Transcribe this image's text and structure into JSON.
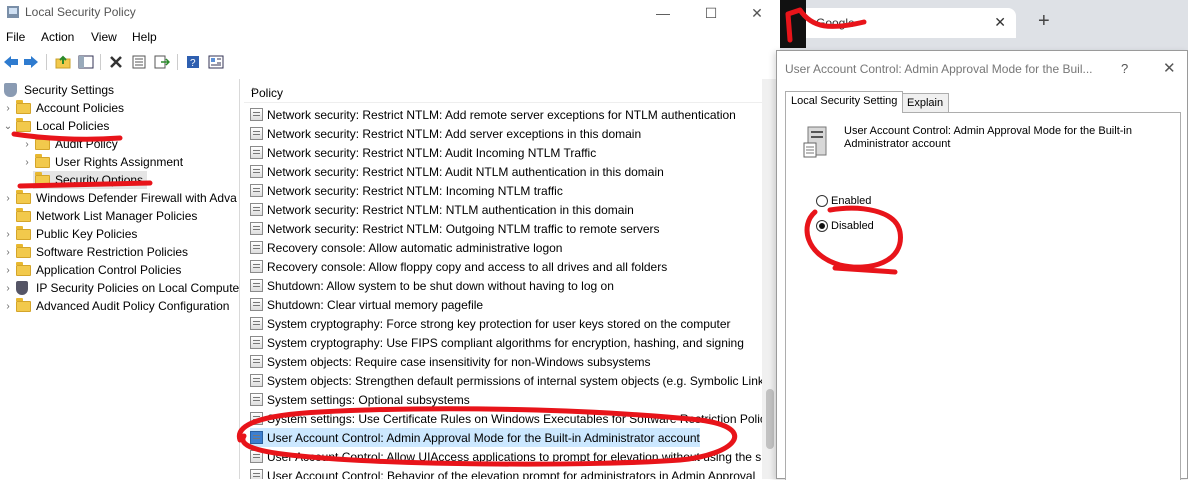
{
  "window": {
    "title": "Local Security Policy",
    "controls": {
      "minimize": "—",
      "maximize": "☐",
      "close": "✕"
    }
  },
  "menu": [
    "File",
    "Action",
    "View",
    "Help"
  ],
  "toolbar_icons": [
    "back-icon",
    "forward-icon",
    "up-folder-icon",
    "show-hide-tree-icon",
    "delete-icon",
    "properties-icon",
    "export-icon",
    "help-icon",
    "details-icon"
  ],
  "tree": {
    "items": [
      {
        "label": "Security Settings"
      },
      {
        "label": "Account Policies"
      },
      {
        "label": "Local Policies"
      },
      {
        "label": "Audit Policy"
      },
      {
        "label": "User Rights Assignment"
      },
      {
        "label": "Security Options"
      },
      {
        "label": "Windows Defender Firewall with Adva"
      },
      {
        "label": "Network List Manager Policies"
      },
      {
        "label": "Public Key Policies"
      },
      {
        "label": "Software Restriction Policies"
      },
      {
        "label": "Application Control Policies"
      },
      {
        "label": "IP Security Policies on Local Compute"
      },
      {
        "label": "Advanced Audit Policy Configuration"
      }
    ]
  },
  "policy_list": {
    "column_header": "Policy",
    "rows": [
      "Network security: Restrict NTLM: Add remote server exceptions for NTLM authentication",
      "Network security: Restrict NTLM: Add server exceptions in this domain",
      "Network security: Restrict NTLM: Audit Incoming NTLM Traffic",
      "Network security: Restrict NTLM: Audit NTLM authentication in this domain",
      "Network security: Restrict NTLM: Incoming NTLM traffic",
      "Network security: Restrict NTLM: NTLM authentication in this domain",
      "Network security: Restrict NTLM: Outgoing NTLM traffic to remote servers",
      "Recovery console: Allow automatic administrative logon",
      "Recovery console: Allow floppy copy and access to all drives and all folders",
      "Shutdown: Allow system to be shut down without having to log on",
      "Shutdown: Clear virtual memory pagefile",
      "System cryptography: Force strong key protection for user keys stored on the computer",
      "System cryptography: Use FIPS compliant algorithms for encryption, hashing, and signing",
      "System objects: Require case insensitivity for non-Windows subsystems",
      "System objects: Strengthen default permissions of internal system objects (e.g. Symbolic Links",
      "System settings: Optional subsystems",
      "System settings: Use Certificate Rules on Windows Executables for Software Restriction Policie",
      "User Account Control: Admin Approval Mode for the Built-in Administrator account",
      "User Account Control: Allow UIAccess applications to prompt for elevation without using the s",
      "User Account Control: Behavior of the elevation prompt for administrators in Admin Approval"
    ]
  },
  "browser": {
    "tab_title": "Google",
    "new_tab": "+",
    "close": "✕"
  },
  "dialog": {
    "title": "User Account Control: Admin Approval Mode for the Buil...",
    "help": "?",
    "close": "✕",
    "tabs": [
      "Local Security Setting",
      "Explain"
    ],
    "description": "User Account Control: Admin Approval Mode for the Built-in Administrator account",
    "options": [
      {
        "label": "Enabled",
        "selected": false
      },
      {
        "label": "Disabled",
        "selected": true
      }
    ]
  },
  "annotation_color": "#e8141a"
}
